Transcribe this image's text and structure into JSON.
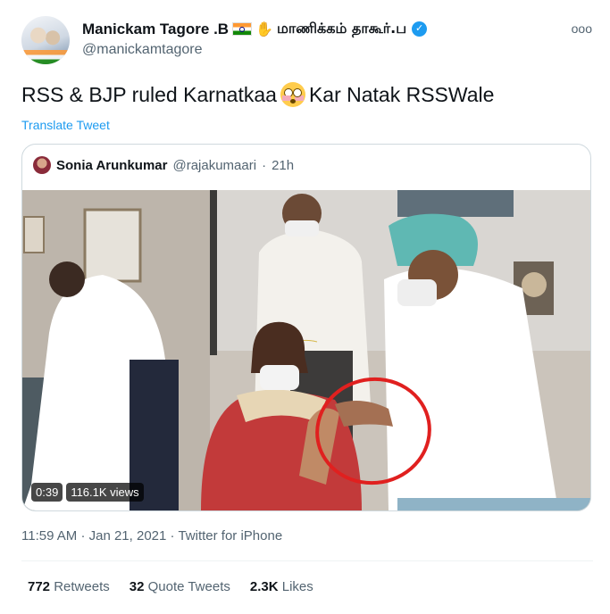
{
  "author": {
    "display_name": "Manickam Tagore .B",
    "tamil_name": "மாணிக்கம் தாகூர்.ப",
    "handle": "@manickamtagore",
    "verified_icon": "verified-badge-icon"
  },
  "more_icon": "ooo",
  "tweet": {
    "text_part1": "RSS & BJP ruled Karnatkaa",
    "text_part2": "Kar Natak RSSWale",
    "translate": "Translate Tweet"
  },
  "quoted": {
    "name": "Sonia Arunkumar",
    "handle": "@rajakumaari",
    "separator": "·",
    "time": "21h",
    "video": {
      "duration": "0:39",
      "views": "116.1K views"
    }
  },
  "meta": {
    "time": "11:59 AM",
    "date": "Jan 21, 2021",
    "source": "Twitter for iPhone",
    "full": "11:59 AM · Jan 21, 2021 · Twitter for iPhone"
  },
  "stats": {
    "retweets_count": "772",
    "retweets_label": "Retweets",
    "quotes_count": "32",
    "quotes_label": "Quote Tweets",
    "likes_count": "2.3K",
    "likes_label": "Likes"
  },
  "colors": {
    "accent": "#1d9bf0",
    "secondary_text": "#536471",
    "border": "#cfd9de",
    "annotation_circle": "#e0201f"
  }
}
